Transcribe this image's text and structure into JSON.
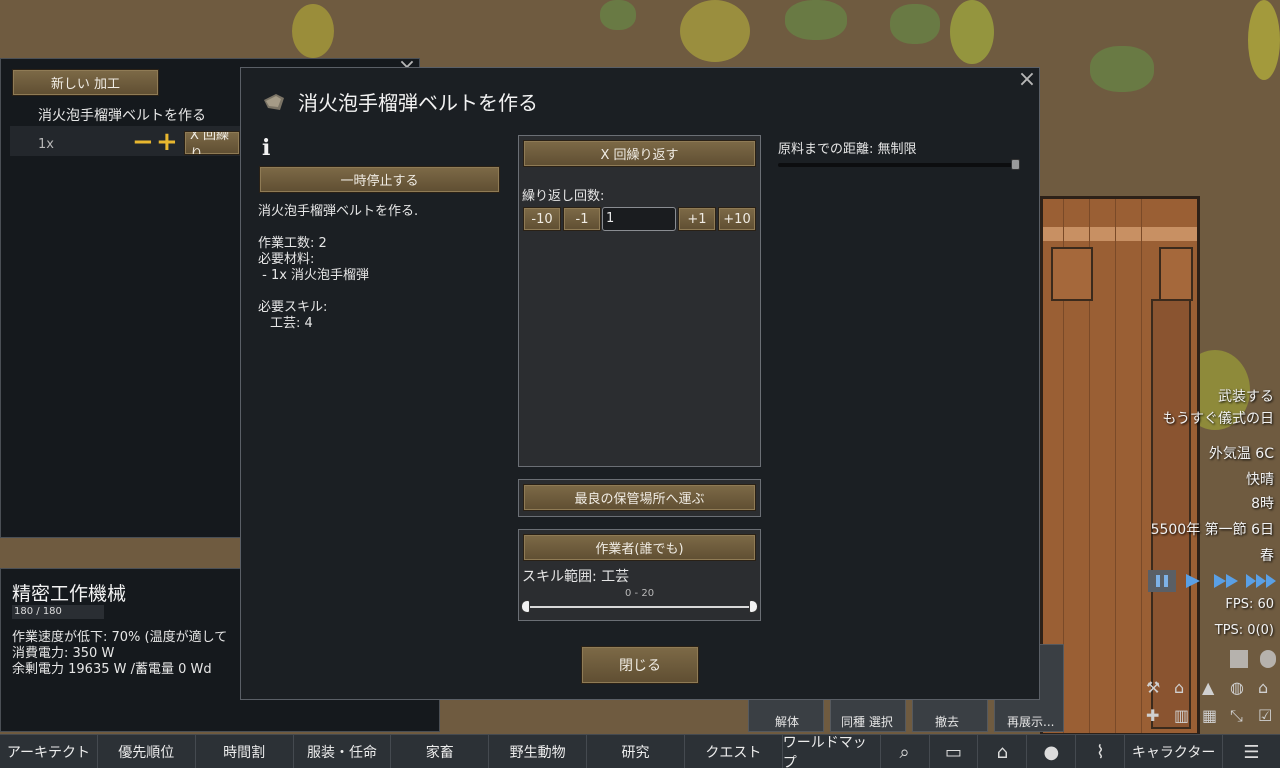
{
  "bill_list": {
    "new_bill_button": "新しい 加工",
    "bill_name": "消火泡手榴弾ベルトを作る",
    "bill_count": "1x",
    "repeat_button_partial": "X 回繰り"
  },
  "inspect": {
    "title": "精密工作機械",
    "hp": "180 / 180",
    "lines": [
      "作業速度が低下: 70% (温度が適して",
      "消費電力: 350 W",
      "余剰電力 19635 W /蓄電量 0 Wd"
    ]
  },
  "dialog": {
    "title": "消火泡手榴弾ベルトを作る",
    "pause_button": "一時停止する",
    "description": "消火泡手榴弾ベルトを作る.",
    "work_amount": "作業工数: 2",
    "ingredients_label": "必要材料:",
    "ingredient_1": " - 1x 消火泡手榴弾",
    "skills_label": "必要スキル:",
    "skill_1": "工芸: 4",
    "repeat_mode_button": "X 回繰り返す",
    "repeat_count_label": "繰り返し回数:",
    "minus10": "-10",
    "minus1": "-1",
    "repeat_count_value": "1",
    "plus1": "+1",
    "plus10": "+10",
    "store_mode_button": "最良の保管場所へ運ぶ",
    "worker_button": "作業者(誰でも)",
    "skill_range_label": "スキル範囲: 工芸",
    "skill_range_value": "0 - 20",
    "ingredient_radius": "原料までの距離: 無制限",
    "close_button": "閉じる"
  },
  "hud": {
    "alert_1": "武装する",
    "alert_2": "もうすぐ儀式の日",
    "outdoor_temp": "外気温 6C",
    "weather": "快晴",
    "time": "8時",
    "date": "5500年 第一節 6日",
    "season": "春",
    "fps": "FPS: 60",
    "tps": "TPS: 0(0)"
  },
  "arch_menu": {
    "item_1": "解体",
    "item_2": "同種 選択",
    "item_3": "撤去",
    "item_4": "再展示..."
  },
  "bottom_tabs": [
    "アーキテクト",
    "優先順位",
    "時間割",
    "服装・任命",
    "家畜",
    "野生動物",
    "研究",
    "クエスト",
    "ワールドマップ"
  ],
  "bottom_tab_last": "キャラクター",
  "bottom_icons": [
    "search-icon",
    "book-icon",
    "factions-icon",
    "lightbulb-icon",
    "broom-icon",
    "menu-icon"
  ],
  "colors": {
    "button_brown": "#6e5c3c",
    "panel_dark": "#1b1f23",
    "accent_yellow": "#e8b72f"
  }
}
